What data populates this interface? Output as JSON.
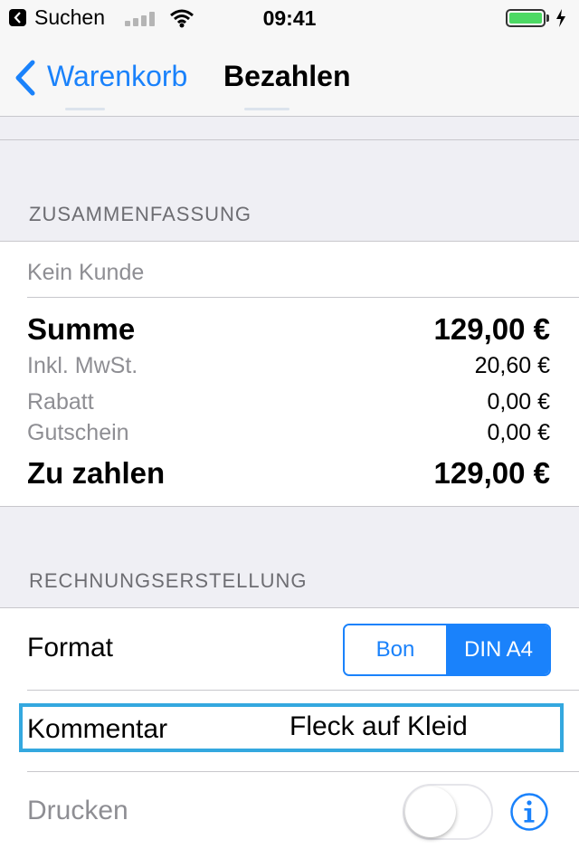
{
  "status_bar": {
    "back_app": "Suchen",
    "time": "09:41"
  },
  "nav": {
    "back_label": "Warenkorb",
    "title": "Bezahlen"
  },
  "summary": {
    "header": "ZUSAMMENFASSUNG",
    "customer": "Kein Kunde",
    "rows": [
      {
        "label": "Summe",
        "value": "129,00 €"
      },
      {
        "label": "Inkl. MwSt.",
        "value": "20,60 €"
      },
      {
        "label": "Rabatt",
        "value": "0,00 €"
      },
      {
        "label": "Gutschein",
        "value": "0,00 €"
      },
      {
        "label": "Zu zahlen",
        "value": "129,00 €"
      }
    ]
  },
  "invoice": {
    "header": "RECHNUNGSERSTELLUNG",
    "format_label": "Format",
    "format_options": [
      "Bon",
      "DIN A4"
    ],
    "format_selected": "DIN A4",
    "comment_label": "Kommentar",
    "comment_value": "Fleck auf Kleid",
    "print_label": "Drucken",
    "print_enabled": false
  },
  "colors": {
    "accent": "#1a82fb",
    "highlight": "#34a8df",
    "battery": "#4cd964"
  }
}
